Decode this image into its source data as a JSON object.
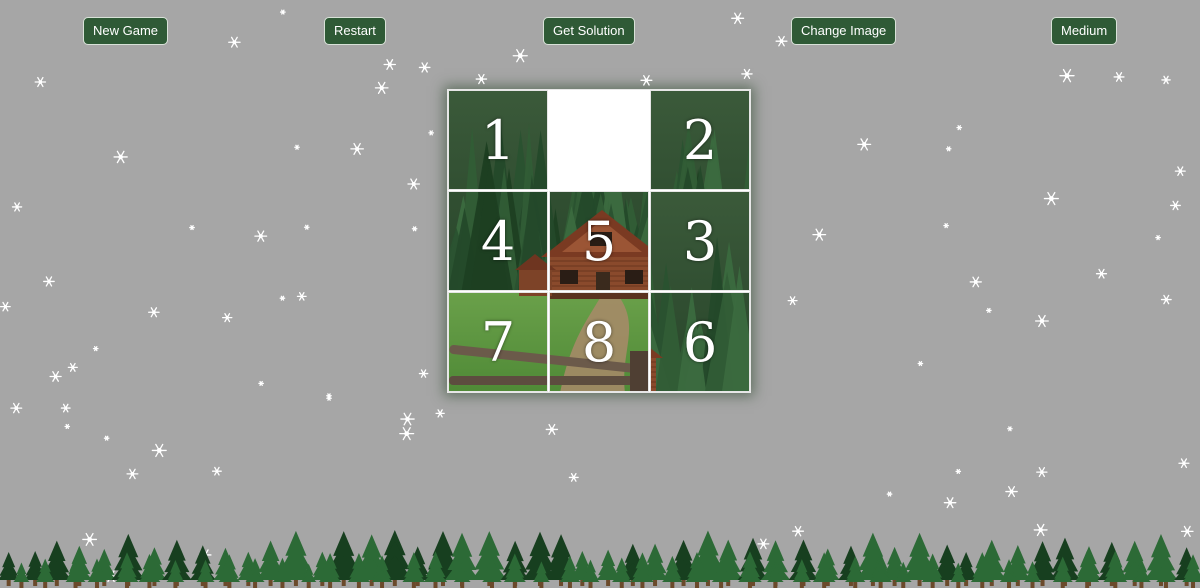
{
  "toolbar": {
    "new_game": "New Game",
    "restart": "Restart",
    "get_solution": "Get Solution",
    "change_image": "Change Image",
    "difficulty": "Medium"
  },
  "puzzle": {
    "grid_size": 3,
    "tiles": [
      {
        "label": "1",
        "piece": 1
      },
      {
        "label": "",
        "piece": 0
      },
      {
        "label": "2",
        "piece": 2
      },
      {
        "label": "4",
        "piece": 4
      },
      {
        "label": "5",
        "piece": 5
      },
      {
        "label": "3",
        "piece": 3
      },
      {
        "label": "7",
        "piece": 7
      },
      {
        "label": "8",
        "piece": 8
      },
      {
        "label": "6",
        "piece": 6
      }
    ],
    "image_subject": "log cabin in a pine forest",
    "empty_color": "#ffffff"
  },
  "colors": {
    "background": "#a6a6a6",
    "button": "#2f5a36",
    "tree_dark": "#173f1f",
    "tree_mid": "#2c6a36",
    "trunk": "#6b4a2b"
  },
  "decor": {
    "snowflake_icon": "snowflake-icon",
    "tree_icon": "pine-tree-icon"
  }
}
